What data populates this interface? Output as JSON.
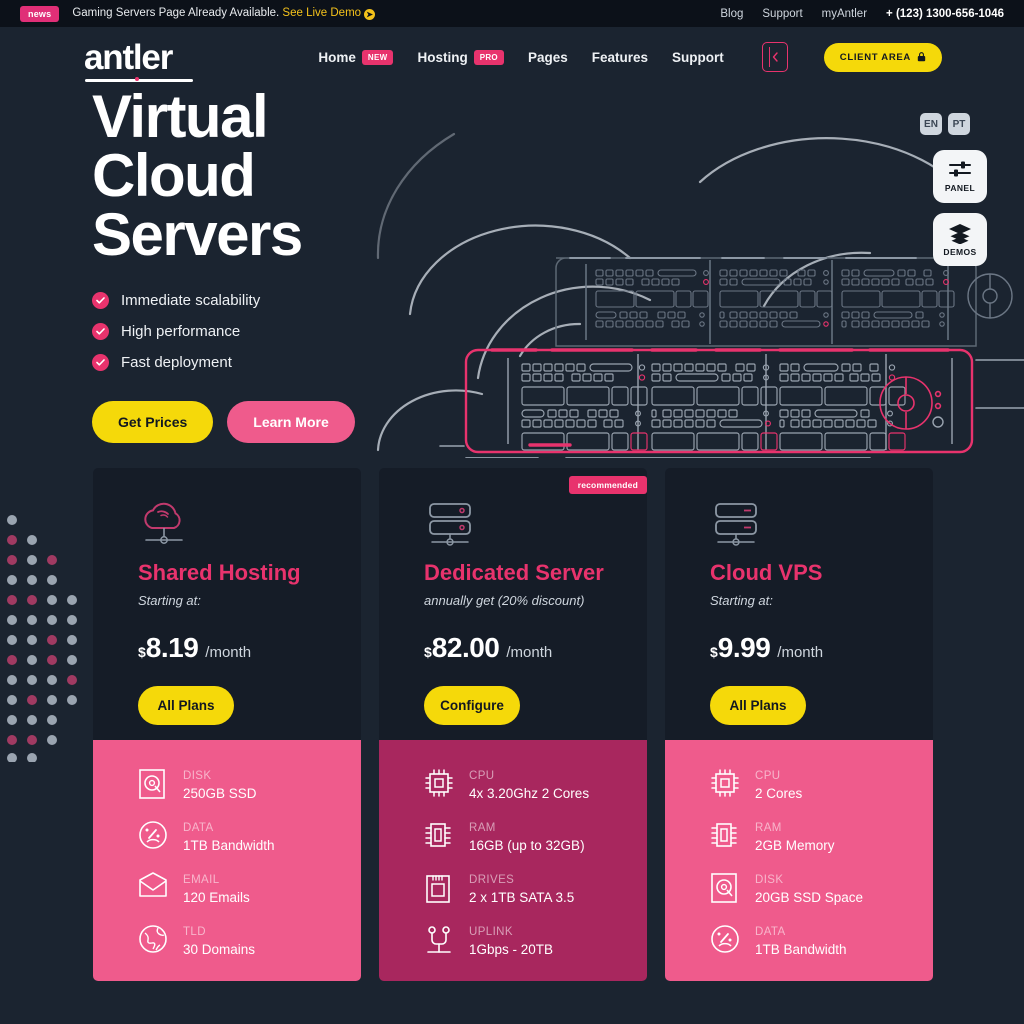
{
  "topbar": {
    "badge": "news",
    "message": "Gaming Servers Page Already Available.",
    "link": "See Live Demo",
    "links": [
      {
        "label": "Blog"
      },
      {
        "label": "Support"
      },
      {
        "label": "myAntler"
      }
    ],
    "phone": "+ (123) 1300-656-1046"
  },
  "header": {
    "logo": "antler",
    "nav": [
      {
        "label": "Home",
        "tag": "NEW"
      },
      {
        "label": "Hosting",
        "tag": "PRO"
      },
      {
        "label": "Pages",
        "tag": ""
      },
      {
        "label": "Features",
        "tag": ""
      },
      {
        "label": "Support",
        "tag": ""
      }
    ],
    "client_area": "CLIENT AREA"
  },
  "hero": {
    "title_line1": "Virtual",
    "title_line2": "Cloud",
    "title_line3": "Servers",
    "features": [
      "Immediate scalability",
      "High performance",
      "Fast deployment"
    ],
    "primary_btn": "Get Prices",
    "secondary_btn": "Learn More"
  },
  "widgets": {
    "languages": [
      "EN",
      "PT"
    ],
    "panel": "PANEL",
    "demos": "DEMOS"
  },
  "pricing": [
    {
      "icon": "cloud-network-icon",
      "badge": "",
      "title": "Shared Hosting",
      "subtitle": "Starting at:",
      "currency": "$",
      "amount": "8.19",
      "period": "/month",
      "button": "All Plans",
      "specs_theme": "pink-a",
      "specs": [
        {
          "icon": "hard-disk-icon",
          "key": "DISK",
          "value": "250GB SSD"
        },
        {
          "icon": "gauge-icon",
          "key": "DATA",
          "value": "1TB Bandwidth"
        },
        {
          "icon": "envelope-icon",
          "key": "EMAIL",
          "value": "120 Emails"
        },
        {
          "icon": "globe-icon",
          "key": "TLD",
          "value": "30 Domains"
        }
      ]
    },
    {
      "icon": "server-rack-icon",
      "badge": "recommended",
      "title": "Dedicated Server",
      "subtitle": "annually get (20% discount)",
      "currency": "$",
      "amount": "82.00",
      "period": "/month",
      "button": "Configure",
      "specs_theme": "pink-b",
      "specs": [
        {
          "icon": "cpu-icon",
          "key": "CPU",
          "value": "4x 3.20Ghz 2 Cores"
        },
        {
          "icon": "ram-icon",
          "key": "RAM",
          "value": "16GB (up to 32GB)"
        },
        {
          "icon": "drive-icon",
          "key": "DRIVES",
          "value": "2 x 1TB SATA 3.5"
        },
        {
          "icon": "uplink-icon",
          "key": "UPLINK",
          "value": "1Gbps - 20TB"
        }
      ]
    },
    {
      "icon": "server-rack-icon",
      "badge": "",
      "title": "Cloud VPS",
      "subtitle": "Starting at:",
      "currency": "$",
      "amount": "9.99",
      "period": "/month",
      "button": "All Plans",
      "specs_theme": "pink-a",
      "specs": [
        {
          "icon": "cpu-icon",
          "key": "CPU",
          "value": "2 Cores"
        },
        {
          "icon": "ram-icon",
          "key": "RAM",
          "value": "2GB Memory"
        },
        {
          "icon": "hard-disk-icon",
          "key": "DISK",
          "value": "20GB SSD Space"
        },
        {
          "icon": "gauge-icon",
          "key": "DATA",
          "value": "1TB Bandwidth"
        }
      ]
    }
  ],
  "colors": {
    "page_bg": "#1b2430",
    "topbar_bg": "#0c1119",
    "card_bg": "#151c27",
    "pink": "#e8336d",
    "pink_light": "#ef5b8c",
    "pink_dark": "#a8275e",
    "yellow": "#f5d90a"
  }
}
